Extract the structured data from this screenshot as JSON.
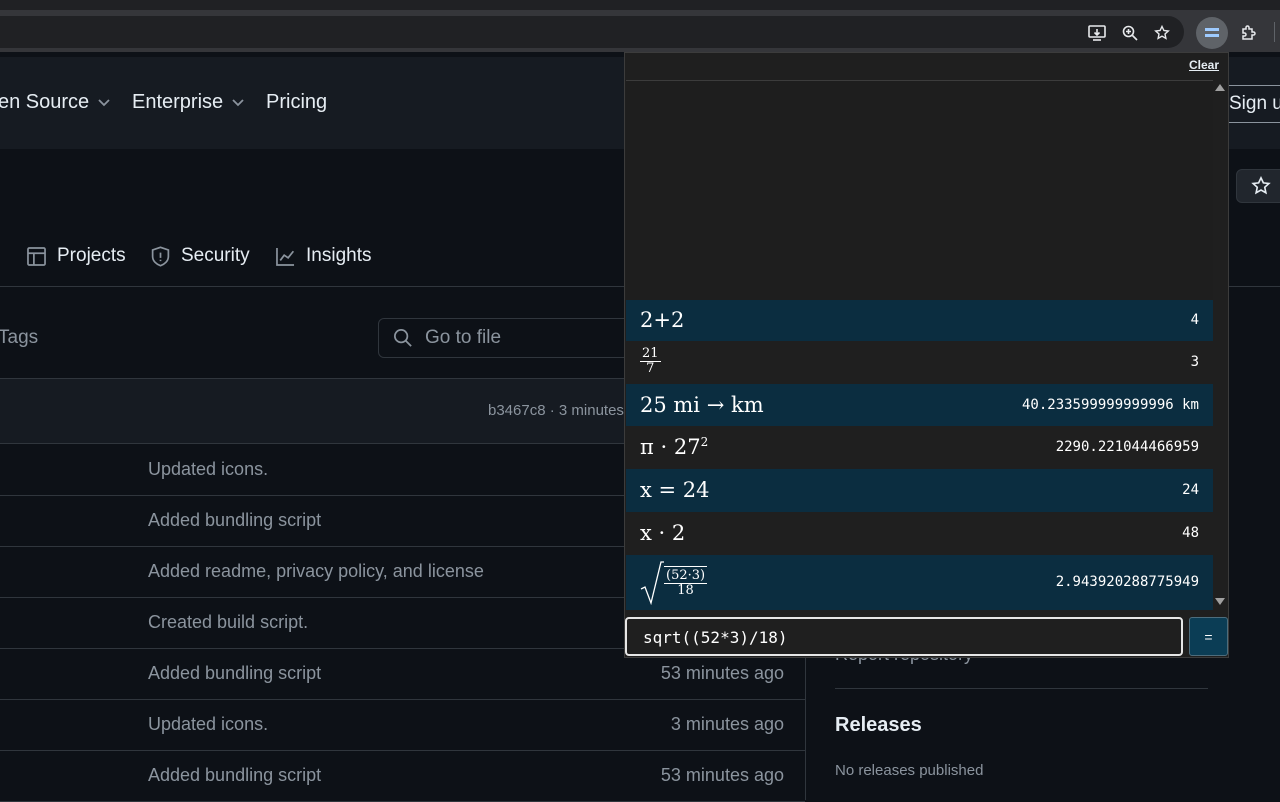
{
  "nav": {
    "open_source": "en Source",
    "enterprise": "Enterprise",
    "pricing": "Pricing",
    "sign_up": "Sign u"
  },
  "tabs": {
    "projects": "Projects",
    "security": "Security",
    "insights": "Insights"
  },
  "files": {
    "tags": "Tags",
    "go_to_file_placeholder": "Go to file",
    "latest_commit": "b3467c8 · 3 minutes",
    "rows": [
      {
        "message": "Updated icons.",
        "time": ""
      },
      {
        "message": "Added bundling script",
        "time": ""
      },
      {
        "message": "Added readme, privacy policy, and license",
        "time": ""
      },
      {
        "message": "Created build script.",
        "time": ""
      },
      {
        "message": "Added bundling script",
        "time": "53 minutes ago"
      },
      {
        "message": "Updated icons.",
        "time": "3 minutes ago"
      },
      {
        "message": "Added bundling script",
        "time": "53 minutes ago"
      }
    ]
  },
  "sidebar": {
    "report": "Report repository",
    "releases_heading": "Releases",
    "no_releases": "No releases published"
  },
  "calculator": {
    "clear_label": "Clear",
    "history": [
      {
        "expr": "2+2",
        "result": "4"
      },
      {
        "expr_num": "21",
        "expr_den": "7",
        "result": "3"
      },
      {
        "expr": "25 mi → km",
        "result": "40.233599999999996 km"
      },
      {
        "expr": "π · 27",
        "expr_sup": "2",
        "result": "2290.221044466959"
      },
      {
        "expr": "x = 24",
        "result": "24"
      },
      {
        "expr": "x · 2",
        "result": "48"
      },
      {
        "expr_num": "(52·3)",
        "expr_den": "18",
        "result": "2.943920288775949"
      }
    ],
    "input_value": "sqrt((52*3)/18)",
    "equals_label": "="
  }
}
